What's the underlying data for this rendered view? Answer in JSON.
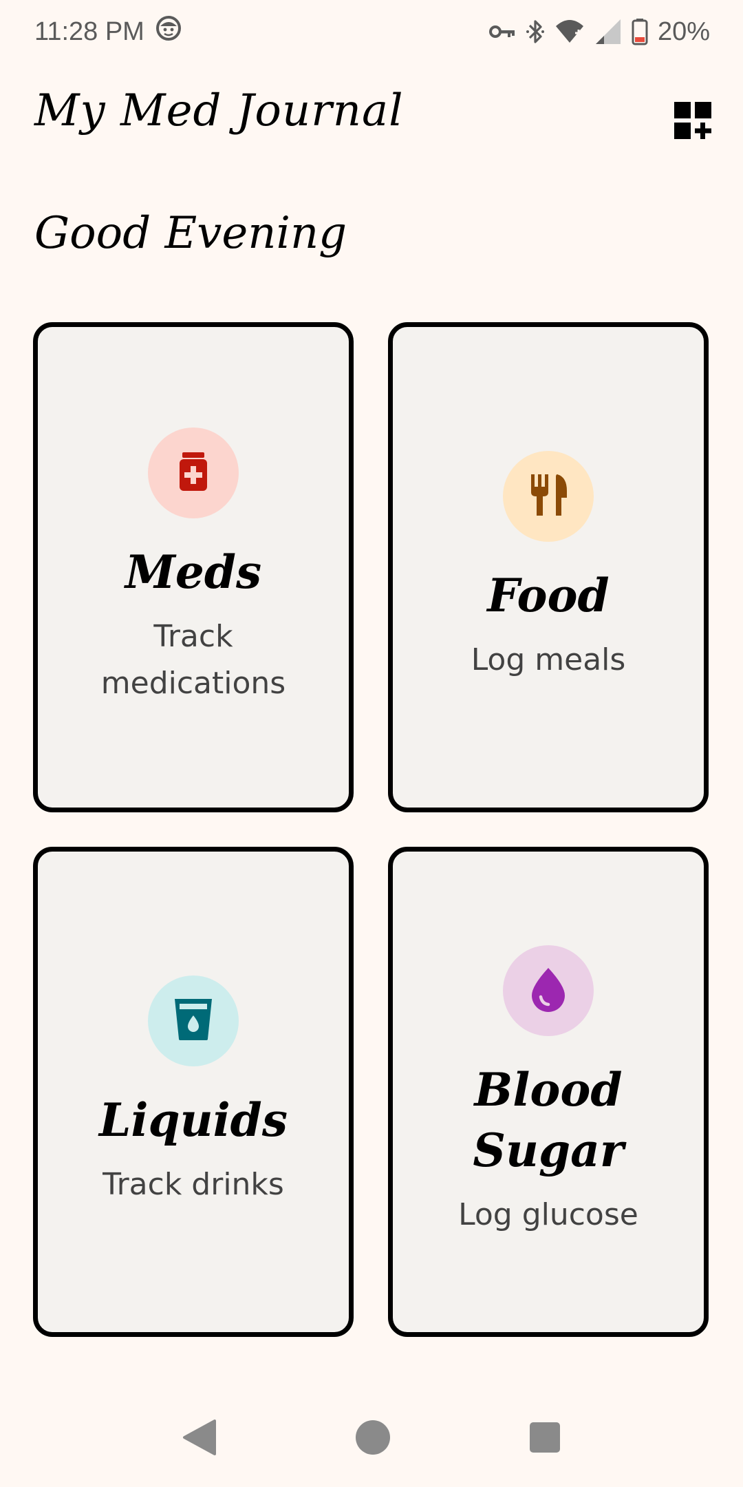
{
  "status_bar": {
    "time": "11:28 PM",
    "battery_percent": "20%",
    "icons": [
      "face-icon",
      "vpn-key-icon",
      "bluetooth-icon",
      "wifi-icon",
      "signal-icon",
      "battery-icon"
    ]
  },
  "app": {
    "title": "My Med Journal",
    "greeting": "Good Evening",
    "action_icon": "grid-add-icon"
  },
  "cards": [
    {
      "title": "Meds",
      "subtitle": "Track medications",
      "icon": "medicine-bottle-icon",
      "icon_color": "#C0180C",
      "circle_color": "#FCD5CE"
    },
    {
      "title": "Food",
      "subtitle": "Log meals",
      "icon": "restaurant-icon",
      "icon_color": "#8B4A06",
      "circle_color": "#FFE6C2"
    },
    {
      "title": "Liquids",
      "subtitle": "Track drinks",
      "icon": "water-glass-icon",
      "icon_color": "#006A77",
      "circle_color": "#CDEDED"
    },
    {
      "title": "Blood Sugar",
      "subtitle": "Log glucose",
      "icon": "blood-drop-icon",
      "icon_color": "#9C27B0",
      "circle_color": "#EBD0E6"
    }
  ],
  "nav": {
    "icons": [
      "back-icon",
      "home-icon",
      "recents-icon"
    ]
  },
  "colors": {
    "background": "#FFF8F3",
    "card_background": "#F4F2EF",
    "card_border": "#000000"
  }
}
